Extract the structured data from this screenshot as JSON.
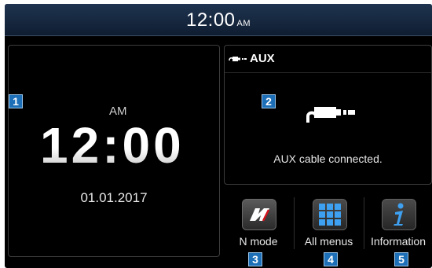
{
  "status_bar": {
    "time": "12:00",
    "ampm": "AM"
  },
  "clock_widget": {
    "ampm": "AM",
    "time": "12:00",
    "date": "01.01.2017"
  },
  "aux_widget": {
    "title": "AUX",
    "message": "AUX cable connected."
  },
  "menu_buttons": [
    {
      "label": "N mode",
      "icon": "n-logo-icon"
    },
    {
      "label": "All menus",
      "icon": "grid-icon"
    },
    {
      "label": "Information",
      "icon": "info-icon"
    }
  ],
  "callouts": [
    "1",
    "2",
    "3",
    "4",
    "5"
  ],
  "colors": {
    "accent": "#1d6fb8",
    "background": "#000000",
    "status_bar": "#1a2d45"
  }
}
